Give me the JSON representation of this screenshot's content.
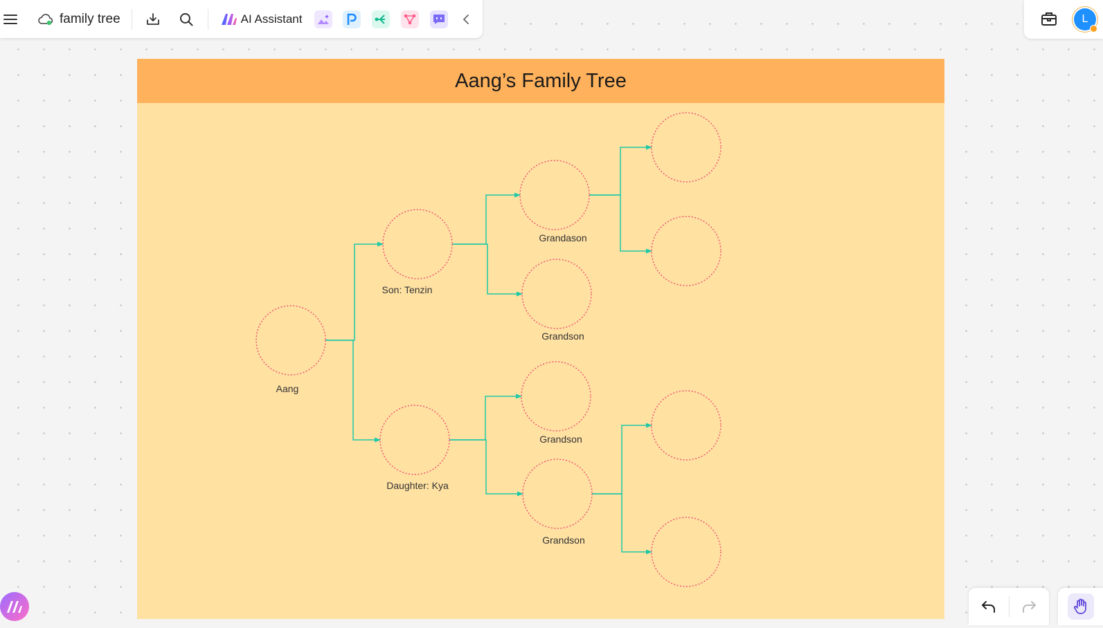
{
  "toolbar": {
    "menu_icon": "hamburger-icon",
    "cloud_icon": "cloud-sync-icon",
    "doc_title": "family tree",
    "ai_assistant_label": "AI Assistant",
    "apps": [
      "ai-image-icon",
      "p-app-icon",
      "mindmap-icon",
      "flowchart-icon",
      "chat-icon"
    ]
  },
  "user": {
    "avatar_initial": "L"
  },
  "board": {
    "title": "Aang’s Family Tree",
    "background": "#ffe1a2",
    "header_color": "#ffb15c"
  },
  "diagram": {
    "node_stroke": "#f0506e",
    "connector_color": "#1fc9a6",
    "nodes": [
      {
        "id": "aang",
        "label": "Aang"
      },
      {
        "id": "tenzin",
        "label": "Son: Tenzin"
      },
      {
        "id": "kya",
        "label": "Daughter: Kya"
      },
      {
        "id": "gs1",
        "label": "Grandason"
      },
      {
        "id": "gs2",
        "label": "Grandson"
      },
      {
        "id": "gs3",
        "label": "Grandson"
      },
      {
        "id": "gs4",
        "label": "Grandson"
      },
      {
        "id": "ggc1",
        "label": ""
      },
      {
        "id": "ggc2",
        "label": ""
      },
      {
        "id": "ggc3",
        "label": ""
      },
      {
        "id": "ggc4",
        "label": ""
      }
    ],
    "edges": [
      [
        "aang",
        "tenzin"
      ],
      [
        "aang",
        "kya"
      ],
      [
        "tenzin",
        "gs1"
      ],
      [
        "tenzin",
        "gs2"
      ],
      [
        "kya",
        "gs3"
      ],
      [
        "kya",
        "gs4"
      ],
      [
        "gs1",
        "ggc1"
      ],
      [
        "gs1",
        "ggc2"
      ],
      [
        "gs4",
        "ggc3"
      ],
      [
        "gs4",
        "ggc4"
      ]
    ]
  }
}
